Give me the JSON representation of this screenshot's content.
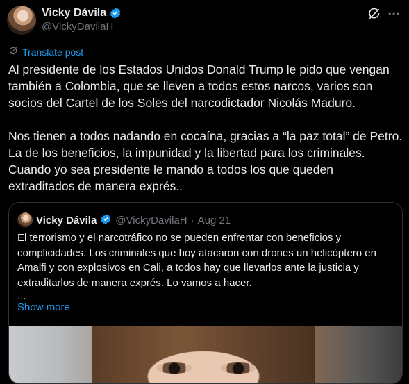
{
  "author": {
    "display_name": "Vicky Dávila",
    "handle": "@VickyDavilaH"
  },
  "icons": {
    "verified": "verified-badge-icon",
    "grok": "grok-icon",
    "more": "more-options-icon",
    "translate": "translate-icon"
  },
  "colors": {
    "background": "#000000",
    "text": "#e7e9ea",
    "secondary": "#71767b",
    "accent": "#1d9bf0",
    "border": "#2f3336"
  },
  "translate_label": "Translate post",
  "post_text": "Al presidente de los Estados Unidos Donald Trump le pido que vengan también a Colombia, que se lleven a todos estos narcos, varios son socios del Cartel de los Soles del narcodictador Nicolás Maduro.\n\nNos tienen a todos nadando en cocaína, gracias a “la paz total” de Petro. La de los beneficios, la impunidad y la libertad para los criminales. Cuando yo sea presidente le mando a todos los que queden extraditados de manera exprés..",
  "quoted": {
    "display_name": "Vicky Dávila",
    "handle": "@VickyDavilaH",
    "separator": "·",
    "date": "Aug 21",
    "text": "El terrorismo y el narcotráfico no se pueden enfrentar con beneficios y complicidades. Los criminales que hoy atacaron con drones un helicóptero en Amalfi y con explosivos en Cali, a todos hay que llevarlos ante la justicia y extraditarlos de manera exprés. Lo vamos a hacer.",
    "ellipsis": "...",
    "show_more": "Show more"
  }
}
